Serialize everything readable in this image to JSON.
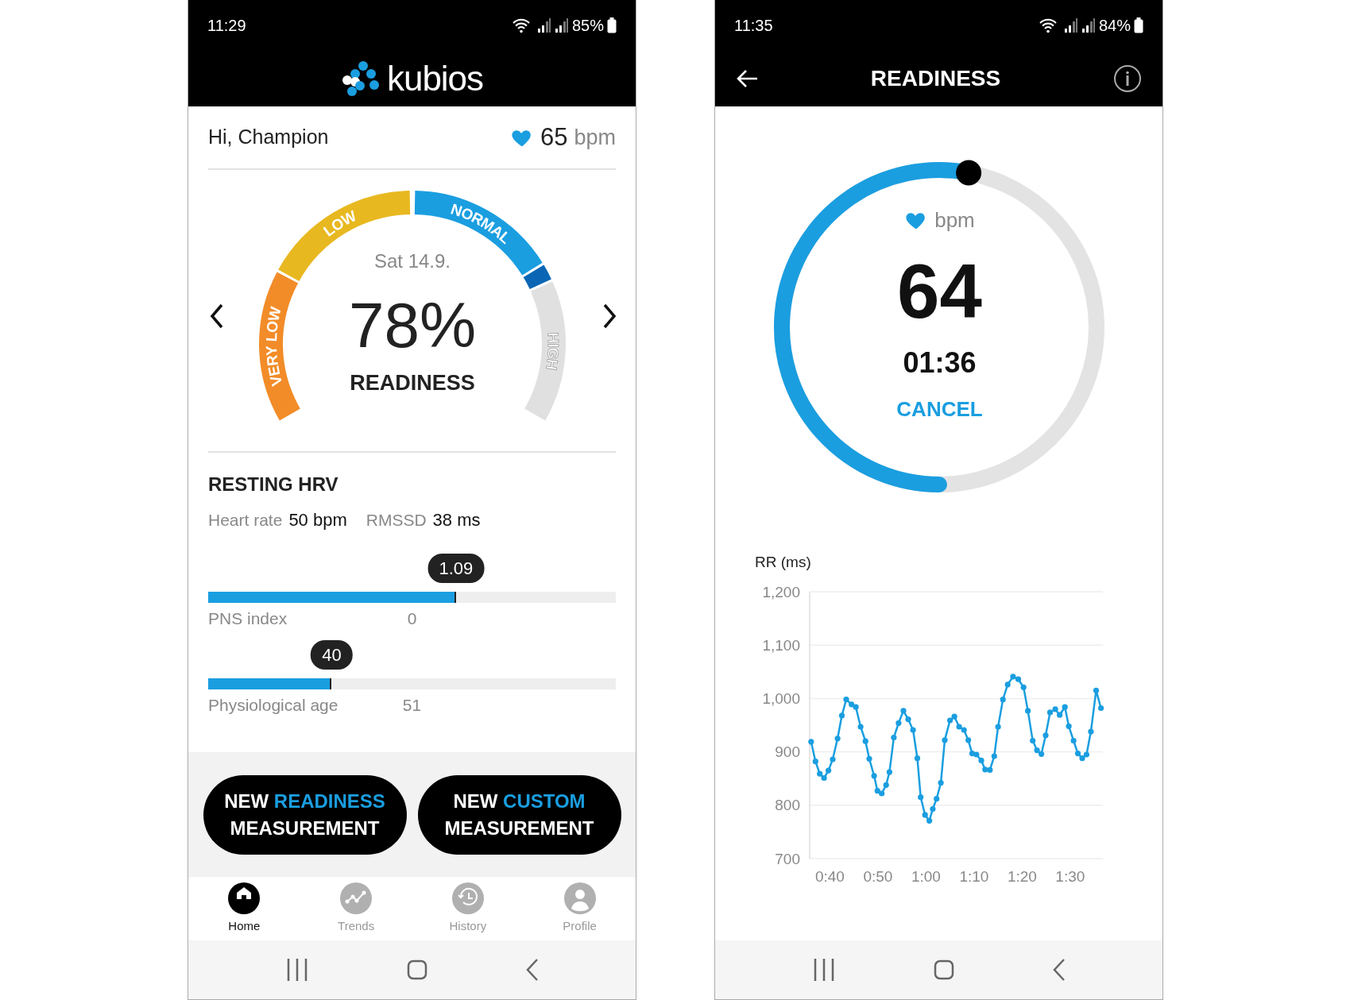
{
  "home_screen": {
    "status_bar": {
      "time": "11:29",
      "battery": "85%"
    },
    "app_bar": {
      "logo_text": "kubios"
    },
    "greeting": "Hi, Champion",
    "heart_rate": {
      "value": "65",
      "unit": "bpm"
    },
    "readiness_gauge": {
      "date": "Sat 14.9.",
      "value": "78%",
      "label": "READINESS",
      "zones": [
        {
          "label": "VERY LOW",
          "color": "#f28c28"
        },
        {
          "label": "LOW",
          "color": "#e8b820"
        },
        {
          "label": "NORMAL",
          "color": "#1a9ee0"
        },
        {
          "label": "HIGH",
          "color": "#e0e0e0"
        }
      ]
    },
    "resting_hrv": {
      "title": "RESTING HRV",
      "stats": [
        {
          "label": "Heart rate",
          "value": "50 bpm"
        },
        {
          "label": "RMSSD",
          "value": "38 ms"
        }
      ],
      "sliders": [
        {
          "label": "PNS index",
          "value": "1.09",
          "midpoint": "0",
          "level": 0.608
        },
        {
          "label": "Physiological age",
          "value": "40",
          "midpoint": "51",
          "level": 0.303
        }
      ]
    },
    "buttons": [
      {
        "prefix": "NEW",
        "highlight": "READINESS",
        "suffix": "MEASUREMENT"
      },
      {
        "prefix": "NEW",
        "highlight": "CUSTOM",
        "suffix": "MEASUREMENT"
      }
    ],
    "bottom_nav": [
      {
        "label": "Home",
        "selected": true
      },
      {
        "label": "Trends",
        "selected": false
      },
      {
        "label": "History",
        "selected": false
      },
      {
        "label": "Profile",
        "selected": false
      }
    ]
  },
  "measurement_screen": {
    "status_bar": {
      "time": "11:35",
      "battery": "84%"
    },
    "title": "READINESS",
    "progress": {
      "level": 0.53
    },
    "heart_unit": "bpm",
    "heart_rate": "64",
    "timer": "01:36",
    "cancel": "CANCEL",
    "chart_data": {
      "type": "line",
      "grid": true,
      "ylabel": "RR (ms)",
      "xlim": [
        35.8,
        96.8
      ],
      "ylim": [
        700,
        1200
      ],
      "xticks": [
        {
          "value": 40,
          "label": "0:40"
        },
        {
          "value": 50,
          "label": "0:50"
        },
        {
          "value": 60,
          "label": "1:00"
        },
        {
          "value": 70,
          "label": "1:10"
        },
        {
          "value": 80,
          "label": "1:20"
        },
        {
          "value": 90,
          "label": "1:30"
        }
      ],
      "yticks": [
        {
          "value": 700,
          "label": "700"
        },
        {
          "value": 800,
          "label": "800"
        },
        {
          "value": 900,
          "label": "900"
        },
        {
          "value": 1000,
          "label": "1,000"
        },
        {
          "value": 1100,
          "label": "1,100"
        },
        {
          "value": 1200,
          "label": "1,200"
        }
      ],
      "x": [
        36.1,
        37.0,
        37.9,
        38.8,
        39.7,
        40.6,
        41.6,
        42.5,
        43.4,
        44.5,
        45.4,
        46.4,
        47.4,
        48.2,
        49.2,
        49.9,
        50.8,
        51.7,
        52.4,
        53.3,
        54.3,
        55.3,
        56.3,
        57.3,
        58.2,
        58.9,
        59.8,
        60.7,
        61.4,
        62.2,
        63.1,
        63.9,
        65.0,
        65.9,
        66.9,
        67.9,
        68.8,
        69.6,
        70.5,
        71.5,
        72.3,
        73.3,
        74.2,
        75.0,
        76.0,
        77.0,
        78.1,
        79.2,
        80.3,
        81.2,
        82.2,
        83.1,
        84.0,
        84.9,
        85.8,
        86.9,
        87.8,
        88.9,
        89.7,
        90.7,
        91.6,
        92.5,
        93.4,
        94.3,
        95.4,
        96.4
      ],
      "series": [
        {
          "color": "#1a9ee0",
          "marker": "circle",
          "values": [
            919,
            882,
            859,
            851,
            865,
            886,
            925,
            968,
            998,
            989,
            984,
            947,
            920,
            887,
            855,
            827,
            822,
            838,
            862,
            927,
            954,
            977,
            961,
            941,
            888,
            815,
            782,
            771,
            793,
            812,
            842,
            922,
            959,
            966,
            947,
            941,
            922,
            897,
            895,
            884,
            867,
            866,
            892,
            947,
            998,
            1026,
            1041,
            1036,
            1021,
            977,
            921,
            903,
            896,
            931,
            974,
            980,
            969,
            984,
            948,
            921,
            897,
            888,
            895,
            938,
            1015,
            982
          ]
        }
      ]
    }
  }
}
